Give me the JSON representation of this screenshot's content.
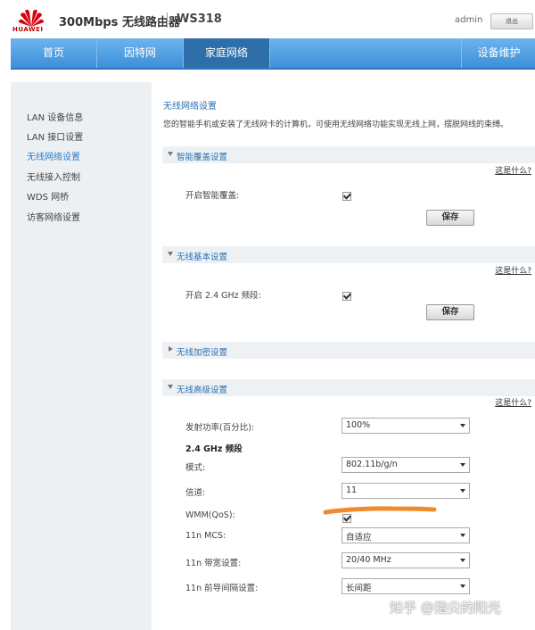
{
  "header": {
    "brand": "HUAWEI",
    "product": "300Mbps 无线路由器",
    "model": "WS318",
    "user": "admin",
    "logout_label": "退出"
  },
  "nav": {
    "items": [
      "首页",
      "因特网",
      "家庭网络"
    ],
    "right_item": "设备维护"
  },
  "sidebar": {
    "items": [
      "LAN 设备信息",
      "LAN 接口设置",
      "无线网络设置",
      "无线接入控制",
      "WDS 网桥",
      "访客网络设置"
    ]
  },
  "content": {
    "title": "无线网络设置",
    "description": "您的智能手机或安装了无线网卡的计算机，可使用无线网络功能实现无线上网，摆脱网线的束缚。",
    "help_label": "这是什么?",
    "save_label": "保存",
    "sections": {
      "smart": {
        "label": "智能覆盖设置",
        "row_label": "开启智能覆盖:"
      },
      "basic": {
        "label": "无线基本设置",
        "row_label": "开启 2.4 GHz 频段:"
      },
      "encrypt": {
        "label": "无线加密设置"
      },
      "advanced": {
        "label": "无线高级设置",
        "power_label": "发射功率(百分比):",
        "power_value": "100%",
        "band_heading": "2.4 GHz 频段",
        "mode_label": "模式:",
        "mode_value": "802.11b/g/n",
        "channel_label": "信道:",
        "channel_value": "11",
        "wmm_label": "WMM(QoS):",
        "mcs_label": "11n MCS:",
        "mcs_value": "自适应",
        "bw_label": "11n 带宽设置:",
        "bw_value": "20/40 MHz",
        "gi_label": "11n 前导间隔设置:",
        "gi_value": "长间距"
      }
    }
  },
  "watermark": "知乎 @指尖的阳光",
  "colors": {
    "nav_blue": "#3d8fd8",
    "nav_active": "#2e6faa",
    "link_blue": "#2b6fb0",
    "annotation_orange": "#f08a2c",
    "brand_red": "#cc0000"
  }
}
